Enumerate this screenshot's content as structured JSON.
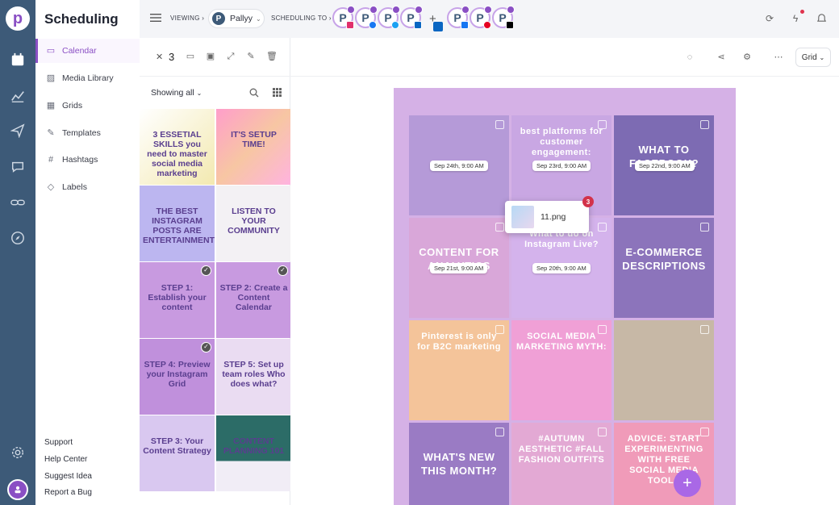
{
  "app": {
    "title": "Scheduling"
  },
  "sidebar": {
    "items": [
      {
        "label": "Calendar",
        "icon": "calendar-icon"
      },
      {
        "label": "Media Library",
        "icon": "image-icon"
      },
      {
        "label": "Grids",
        "icon": "grid-icon"
      },
      {
        "label": "Templates",
        "icon": "edit-icon"
      },
      {
        "label": "Hashtags",
        "icon": "hash-icon"
      },
      {
        "label": "Labels",
        "icon": "tag-icon"
      }
    ],
    "footer": [
      "Support",
      "Help Center",
      "Suggest Idea",
      "Report a Bug"
    ]
  },
  "topbar": {
    "viewing_label": "VIEWING",
    "brand": "Pallyy",
    "scheduling_label": "SCHEDULING TO",
    "accounts": [
      {
        "network": "instagram",
        "color": "#e1306c"
      },
      {
        "network": "facebook",
        "color": "#1877f2"
      },
      {
        "network": "twitter",
        "color": "#1da1f2"
      },
      {
        "network": "linkedin",
        "color": "#0a66c2"
      },
      {
        "network": "linkedin-page",
        "color": "#0a66c2"
      },
      {
        "network": "facebook-group",
        "color": "#1877f2"
      },
      {
        "network": "pinterest",
        "color": "#e60023"
      },
      {
        "network": "tiktok",
        "color": "#000000"
      }
    ],
    "plus": "+"
  },
  "media": {
    "selected_count": "3",
    "filter": "Showing all",
    "thumbs": [
      {
        "text": "3 ESSETIAL SKILLS you need to master social media marketing",
        "bg": "linear-gradient(135deg,#ffffff,#f3e9b0)",
        "checked": false
      },
      {
        "text": "IT'S SETUP TIME!",
        "bg": "linear-gradient(135deg,#ff9ecb,#f7c6a3,#ffb3e0)",
        "checked": false
      },
      {
        "text": "THE BEST INSTAGRAM POSTS ARE ENTERTAINMENT",
        "bg": "#bcb6f0",
        "checked": false
      },
      {
        "text": "LISTEN TO YOUR COMMUNITY",
        "bg": "#f3f1f4",
        "checked": false
      },
      {
        "text": "STEP 1: Establish your content",
        "bg": "#c89ae0",
        "checked": true
      },
      {
        "text": "STEP 2: Create a Content Calendar",
        "bg": "#c89ae0",
        "checked": true
      },
      {
        "text": "STEP 4: Preview your Instagram Grid",
        "bg": "#c090dc",
        "checked": true
      },
      {
        "text": "STEP 5: Set up team roles Who does what?",
        "bg": "#eadcf2",
        "checked": false
      },
      {
        "text": "STEP 3: Your Content Strategy",
        "bg": "#d9c8f0",
        "checked": false
      },
      {
        "text": "CONTENT PLANNING 101",
        "bg": "linear-gradient(#2c6c67 60%,#f1edf6 60%)",
        "checked": false
      }
    ]
  },
  "main": {
    "view": "Grid",
    "drag": {
      "file": "11.png",
      "count": "3"
    },
    "tiles": [
      {
        "text": "",
        "bg": "#b59ad8",
        "sched": "Sep 24th, 9:00 AM"
      },
      {
        "text": "best platforms for customer engagement:",
        "bg": "#c9a7e3",
        "sched": "Sep 23rd, 9:00 AM"
      },
      {
        "text": "WHAT TO FACEBOOK?",
        "bg": "#7d6bb3",
        "sched": "Sep 22nd, 9:00 AM"
      },
      {
        "text": "CONTENT FOR ANALYTICS",
        "bg": "#d9a7d9",
        "sched": "Sep 21st, 9:00 AM"
      },
      {
        "text": "What to do on Instagram Live?",
        "bg": "#d4b3ec",
        "sched": "Sep 20th, 9:00 AM"
      },
      {
        "text": "E-COMMERCE DESCRIPTIONS",
        "bg": "#8c74bb",
        "sched": ""
      },
      {
        "text": "Pinterest is only for B2C marketing",
        "bg": "#f4c49a",
        "sched": ""
      },
      {
        "text": "SOCIAL MEDIA MARKETING MYTH:",
        "bg": "#f0a0d6",
        "sched": ""
      },
      {
        "text": "",
        "bg": "#c7b8a6",
        "sched": ""
      },
      {
        "text": "WHAT'S NEW THIS MONTH?",
        "bg": "#9a7bc4",
        "sched": ""
      },
      {
        "text": "#AUTUMN AESTHETIC #FALL FASHION OUTFITS",
        "bg": "#e3a9d4",
        "sched": ""
      },
      {
        "text": "ADVICE: START EXPERIMENTING WITH FREE SOCIAL MEDIA TOOLS",
        "bg": "#f09bb9",
        "sched": ""
      }
    ]
  }
}
